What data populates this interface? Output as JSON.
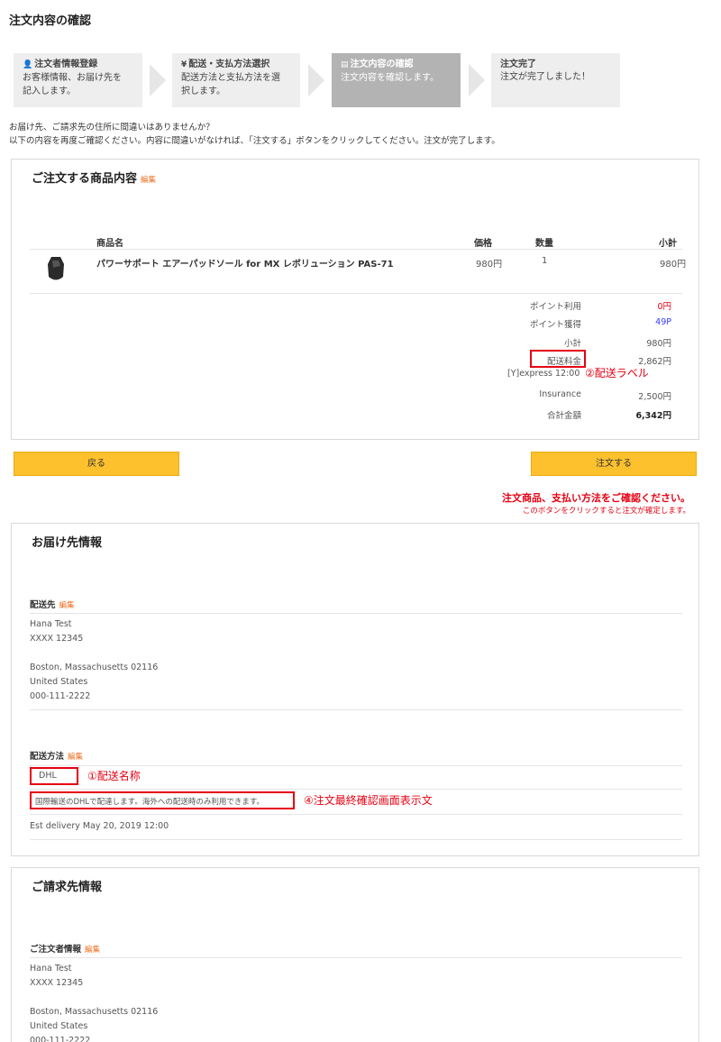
{
  "page_title": "注文内容の確認",
  "steps": [
    {
      "icon": "user-icon",
      "glyph": "👤",
      "title": "注文者情報登録",
      "desc_line1": "お客様情報、お届け先を",
      "desc_line2": "記入します。"
    },
    {
      "icon": "yen-icon",
      "glyph": "¥",
      "title": "配送・支払方法選択",
      "desc_line1": "配送方法と支払方法を選",
      "desc_line2": "択します。"
    },
    {
      "icon": "document-icon",
      "glyph": "▤",
      "title": "注文内容の確認",
      "desc_line1": "注文内容を確認します。",
      "desc_line2": ""
    },
    {
      "icon": "",
      "glyph": "",
      "title": "注文完了",
      "desc_line1": "注文が完了しました！",
      "desc_line2": ""
    }
  ],
  "intro": {
    "line1": "お届け先、ご請求先の住所に間違いはありませんか？",
    "line2": "以下の内容を再度ご確認ください。内容に間違いがなければ、「注文する」ボタンをクリックしてください。注文が完了します。"
  },
  "order": {
    "title": "ご注文する商品内容",
    "edit": "編集",
    "headers": {
      "name": "商品名",
      "price": "価格",
      "qty": "数量",
      "subtotal": "小計"
    },
    "items": [
      {
        "name": "パワーサポート エアーパッドソール for MX レボリューション PAS-71",
        "price": "980円",
        "qty": "1",
        "subtotal": "980円"
      }
    ],
    "summary": {
      "points_used_label": "ポイント利用",
      "points_used": "0円",
      "points_earned_label": "ポイント獲得",
      "points_earned": "49P",
      "subtotal_label": "小計",
      "subtotal": "980円",
      "shipping_label": "配送料金",
      "shipping": "2,862円",
      "shipping_method": "[Y]express 12:00",
      "insurance_label": "Insurance",
      "insurance": "2,500円",
      "total_label": "合計金額",
      "total": "6,342円"
    }
  },
  "annotations": {
    "shipping_label": "②配送ラベル",
    "shipping_name": "①配送名称",
    "final_confirm_text": "④注文最終確認画面表示文"
  },
  "buttons": {
    "back": "戻る",
    "order": "注文する"
  },
  "notice": {
    "line1": "注文商品、支払い方法をご確認ください。",
    "line2": "このボタンをクリックすると注文が確定します。"
  },
  "delivery": {
    "title": "お届け先情報",
    "address_label": "配送先",
    "edit": "編集",
    "name": "Hana Test",
    "line1": "XXXX 12345",
    "city": "Boston, Massachusetts 02116",
    "country": "United States",
    "phone": "000-111-2222",
    "method_label": "配送方法",
    "method_edit": "編集",
    "method_name": "DHL",
    "method_desc": "国際輸送のDHLで配達します。海外への配送時のみ利用できます。",
    "est": "Est delivery May 20, 2019 12:00"
  },
  "billing": {
    "title": "ご請求先情報",
    "label": "ご注文者情報",
    "edit": "編集",
    "name": "Hana Test",
    "line1": "XXXX 12345",
    "city": "Boston, Massachusetts 02116",
    "country": "United States",
    "phone": "000-111-2222"
  }
}
